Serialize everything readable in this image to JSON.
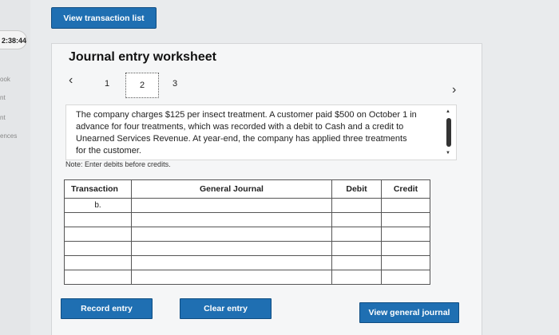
{
  "header": {
    "view_transaction_list_label": "View transaction list"
  },
  "sidebar": {
    "timer": "2:38:44",
    "links": [
      "ook",
      "nt",
      "nt",
      "ences"
    ]
  },
  "worksheet": {
    "title": "Journal entry worksheet",
    "nav": {
      "prev_icon": "‹",
      "next_icon": "›",
      "pages": [
        "1",
        "2",
        "3"
      ],
      "active_page": "2"
    },
    "description": "The company charges $125 per insect treatment. A customer paid $500 on October 1 in advance for four treatments, which was recorded with a debit to Cash and a credit to Unearned Services Revenue. At year-end, the company has applied three treatments for the customer.",
    "note": "Note: Enter debits before credits."
  },
  "table": {
    "headers": [
      "Transaction",
      "General Journal",
      "Debit",
      "Credit"
    ],
    "rows": [
      {
        "transaction": "b.",
        "account": "",
        "debit": "",
        "credit": ""
      },
      {
        "transaction": "",
        "account": "",
        "debit": "",
        "credit": ""
      },
      {
        "transaction": "",
        "account": "",
        "debit": "",
        "credit": ""
      },
      {
        "transaction": "",
        "account": "",
        "debit": "",
        "credit": ""
      },
      {
        "transaction": "",
        "account": "",
        "debit": "",
        "credit": ""
      },
      {
        "transaction": "",
        "account": "",
        "debit": "",
        "credit": ""
      }
    ]
  },
  "buttons": {
    "record": "Record entry",
    "clear": "Clear entry",
    "view_journal": "View general journal"
  },
  "colors": {
    "accent": "#1f6fb2",
    "panel": "#f5f6f7"
  }
}
